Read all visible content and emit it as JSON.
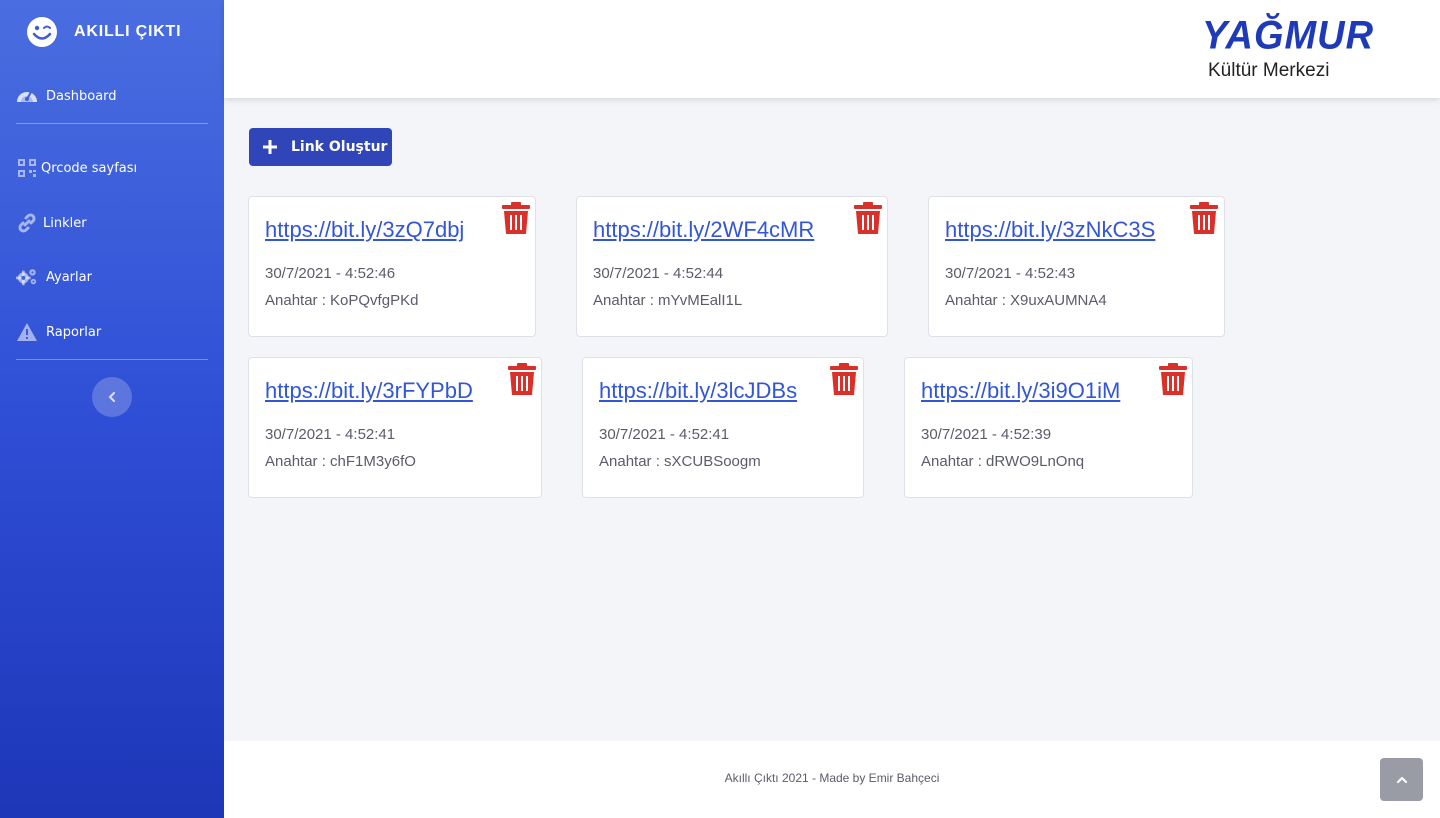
{
  "brand": {
    "name": "AKILLI ÇIKTI",
    "icon": "smile-wink-icon"
  },
  "sidebar": {
    "items": [
      {
        "label": "Dashboard",
        "icon": "tachometer-icon"
      },
      {
        "label": "Qrcode sayfası",
        "icon": "qrcode-icon"
      },
      {
        "label": "Linkler",
        "icon": "link-icon"
      },
      {
        "label": "Ayarlar",
        "icon": "cogs-icon"
      },
      {
        "label": "Raporlar",
        "icon": "warning-icon"
      }
    ],
    "toggle_icon": "chevron-left-icon"
  },
  "header": {
    "logo_title": "YAĞMUR",
    "logo_subtitle": "Kültür Merkezi"
  },
  "main": {
    "create_button": "Link Oluştur",
    "cards": [
      {
        "url": "https://bit.ly/3zQ7dbj",
        "date": "30/7/2021 - 4:52:46",
        "key": "Anahtar : KoPQvfgPKd"
      },
      {
        "url": "https://bit.ly/2WF4cMR",
        "date": "30/7/2021 - 4:52:44",
        "key": "Anahtar : mYvMEalI1L"
      },
      {
        "url": "https://bit.ly/3zNkC3S",
        "date": "30/7/2021 - 4:52:43",
        "key": "Anahtar : X9uxAUMNA4"
      },
      {
        "url": "https://bit.ly/3rFYPbD",
        "date": "30/7/2021 - 4:52:41",
        "key": "Anahtar : chF1M3y6fO"
      },
      {
        "url": "https://bit.ly/3lcJDBs",
        "date": "30/7/2021 - 4:52:41",
        "key": "Anahtar : sXCUBSoogm"
      },
      {
        "url": "https://bit.ly/3i9O1iM",
        "date": "30/7/2021 - 4:52:39",
        "key": "Anahtar : dRWO9LnOnq"
      }
    ]
  },
  "footer": {
    "text": "Akıllı Çıktı 2021 - Made by Emir Bahçeci"
  },
  "colors": {
    "sidebar_top": "#4a6ee0",
    "sidebar_bottom": "#1e36b8",
    "primary": "#2f45b8",
    "link": "#3356d6",
    "danger": "#d9302a"
  }
}
